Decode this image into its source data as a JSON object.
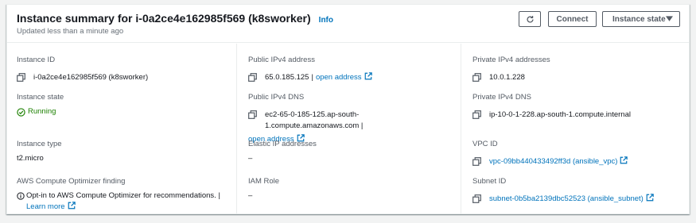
{
  "header": {
    "title": "Instance summary for i-0a2ce4e162985f569 (k8sworker)",
    "info_label": "Info",
    "subtitle": "Updated less than a minute ago",
    "connect_label": "Connect",
    "instance_state_label": "Instance state"
  },
  "col1": {
    "instance_id_label": "Instance ID",
    "instance_id_value": "i-0a2ce4e162985f569 (k8sworker)",
    "instance_state_label": "Instance state",
    "instance_state_value": "Running",
    "instance_type_label": "Instance type",
    "instance_type_value": "t2.micro",
    "optimizer_label": "AWS Compute Optimizer finding",
    "optimizer_text": "Opt-in to AWS Compute Optimizer for recommendations. |",
    "optimizer_link": "Learn more"
  },
  "col2": {
    "public_ipv4_label": "Public IPv4 address",
    "public_ipv4_value": "65.0.185.125",
    "public_ipv4_link": "open address",
    "public_dns_label": "Public IPv4 DNS",
    "public_dns_value": "ec2-65-0-185-125.ap-south-1.compute.amazonaws.com",
    "public_dns_link": "open address",
    "elastic_ip_label": "Elastic IP addresses",
    "elastic_ip_value": "–",
    "iam_role_label": "IAM Role",
    "iam_role_value": "–"
  },
  "col3": {
    "private_ipv4_label": "Private IPv4 addresses",
    "private_ipv4_value": "10.0.1.228",
    "private_dns_label": "Private IPv4 DNS",
    "private_dns_value": "ip-10-0-1-228.ap-south-1.compute.internal",
    "vpc_label": "VPC ID",
    "vpc_value": "vpc-09bb440433492ff3d (ansible_vpc)",
    "subnet_label": "Subnet ID",
    "subnet_value": "subnet-0b5ba2139dbc52523 (ansible_subnet)"
  },
  "colors": {
    "link": "#0073bb",
    "running": "#1d8102",
    "text": "#16191f",
    "label": "#545b64"
  }
}
